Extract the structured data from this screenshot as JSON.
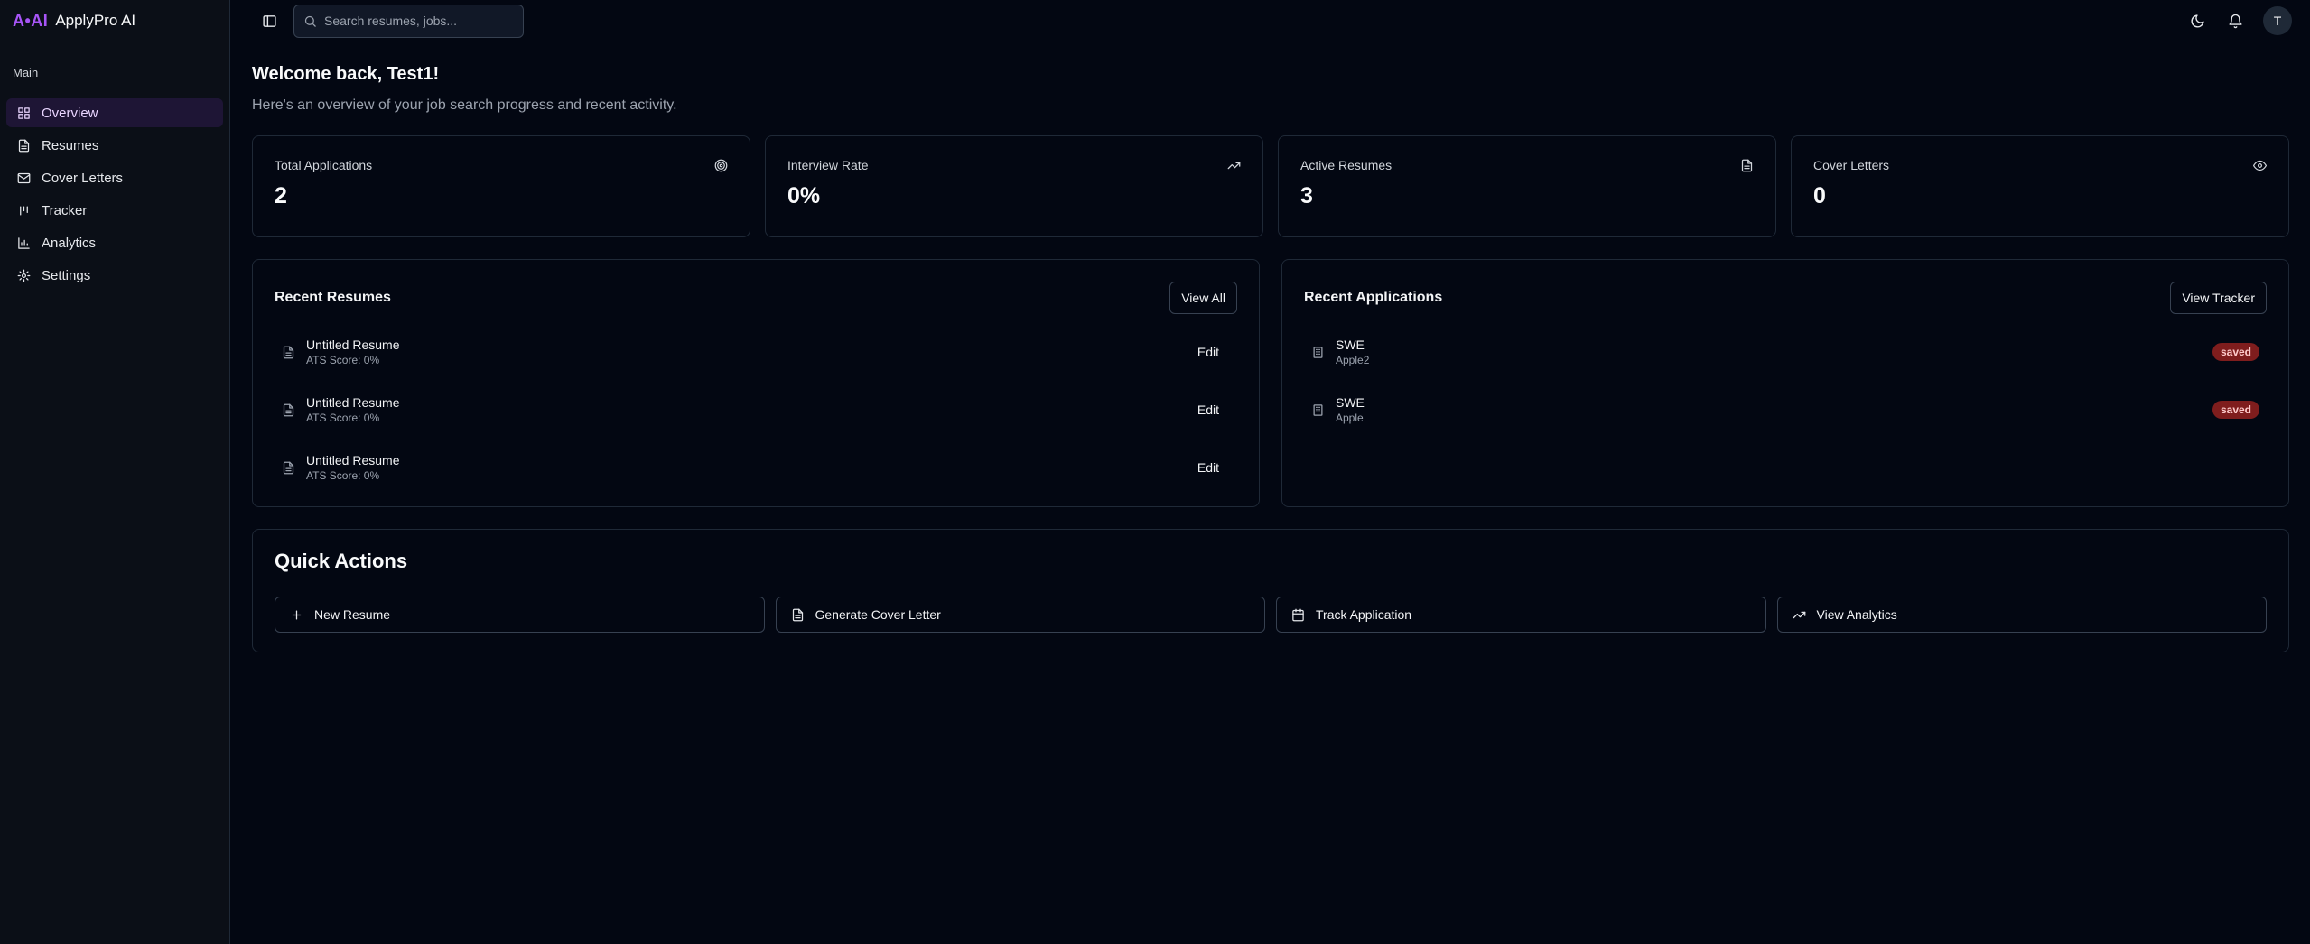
{
  "brand": {
    "logo": "A•AI",
    "name": "ApplyPro AI"
  },
  "sidebar": {
    "group_label": "Main",
    "items": [
      {
        "label": "Overview",
        "icon": "layout-grid-icon",
        "active": true
      },
      {
        "label": "Resumes",
        "icon": "file-text-icon"
      },
      {
        "label": "Cover Letters",
        "icon": "mail-icon"
      },
      {
        "label": "Tracker",
        "icon": "kanban-icon"
      },
      {
        "label": "Analytics",
        "icon": "bar-chart-icon"
      },
      {
        "label": "Settings",
        "icon": "gear-icon"
      }
    ]
  },
  "topbar": {
    "search_placeholder": "Search resumes, jobs...",
    "avatar_initial": "T"
  },
  "header": {
    "welcome": "Welcome back, Test1!",
    "subtitle": "Here's an overview of your job search progress and recent activity."
  },
  "stats": [
    {
      "label": "Total Applications",
      "value": "2",
      "icon": "target-icon"
    },
    {
      "label": "Interview Rate",
      "value": "0%",
      "icon": "trending-up-icon"
    },
    {
      "label": "Active Resumes",
      "value": "3",
      "icon": "file-text-icon"
    },
    {
      "label": "Cover Letters",
      "value": "0",
      "icon": "eye-icon"
    }
  ],
  "recent_resumes": {
    "title": "Recent Resumes",
    "action": "View All",
    "edit_label": "Edit",
    "items": [
      {
        "title": "Untitled Resume",
        "sub": "ATS Score: 0%"
      },
      {
        "title": "Untitled Resume",
        "sub": "ATS Score: 0%"
      },
      {
        "title": "Untitled Resume",
        "sub": "ATS Score: 0%"
      }
    ]
  },
  "recent_applications": {
    "title": "Recent Applications",
    "action": "View Tracker",
    "items": [
      {
        "title": "SWE",
        "sub": "Apple2",
        "status": "saved"
      },
      {
        "title": "SWE",
        "sub": "Apple",
        "status": "saved"
      }
    ]
  },
  "quick_actions": {
    "title": "Quick Actions",
    "items": [
      {
        "label": "New Resume",
        "icon": "plus-icon"
      },
      {
        "label": "Generate Cover Letter",
        "icon": "file-text-icon"
      },
      {
        "label": "Track Application",
        "icon": "calendar-icon"
      },
      {
        "label": "View Analytics",
        "icon": "trending-up-icon"
      }
    ]
  },
  "colors": {
    "background": "#030712",
    "sidebar": "#0b0f17",
    "accent": "#a855f7",
    "active_nav": "#1e1535",
    "badge_saved": "#7f1d1d",
    "border": "#1f2937"
  }
}
